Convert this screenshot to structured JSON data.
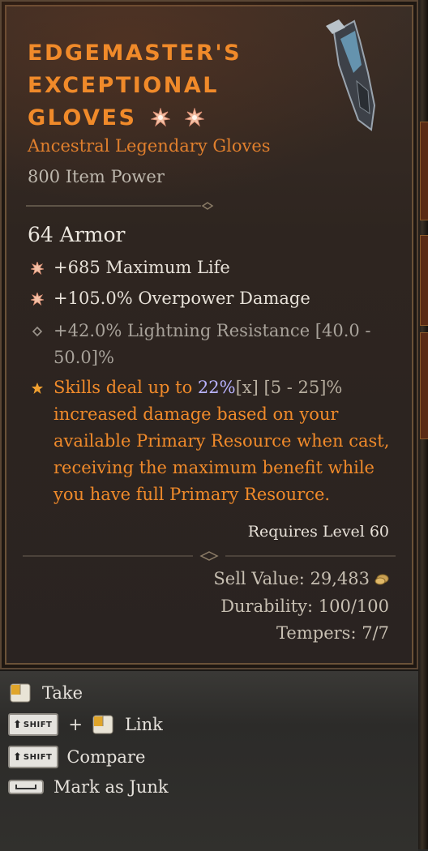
{
  "item": {
    "name_lines": [
      "Edgemaster's",
      "Exceptional",
      "Gloves"
    ],
    "type": "Ancestral Legendary Gloves",
    "item_power": "800 Item Power",
    "armor": "64 Armor",
    "affixes": [
      {
        "text": "+685 Maximum Life",
        "icon": "greater-affix-icon",
        "color": "white"
      },
      {
        "text": "+105.0% Overpower Damage",
        "icon": "greater-affix-icon",
        "color": "white"
      },
      {
        "text_lines": [
          "+42.0% Lightning Resistance [40.0 -",
          "50.0]%"
        ],
        "icon": "diamond-bullet-icon",
        "color": "grey"
      }
    ],
    "legendary_aspect": {
      "line1_prefix": "Skills deal up to ",
      "value": "22%",
      "value_marker": "[x]",
      "range": " [5 - 25]%",
      "lines": [
        "increased damage based on your",
        "available Primary Resource when cast,",
        "receiving the maximum benefit while",
        "you have full Primary Resource."
      ],
      "icon": "legendary-star-icon"
    },
    "requires_level": "Requires Level 60",
    "sell_value": "Sell Value: 29,483",
    "durability": "Durability: 100/100",
    "tempers": "Tempers: 7/7"
  },
  "actions": [
    {
      "label": "Take",
      "icon": "mouse-left-click-icon"
    },
    {
      "label": "Link",
      "modifier": "SHIFT",
      "plus": "+",
      "icon": "mouse-left-click-icon"
    },
    {
      "label": "Compare",
      "modifier": "SHIFT"
    },
    {
      "label": "Mark as Junk",
      "icon": "spacebar-key-icon"
    }
  ],
  "colors": {
    "legendary_orange": "#f08a2a",
    "rolled_value_blue": "#b9b3ff",
    "text_white": "#e7e1d8",
    "text_grey": "#a8a29a"
  }
}
